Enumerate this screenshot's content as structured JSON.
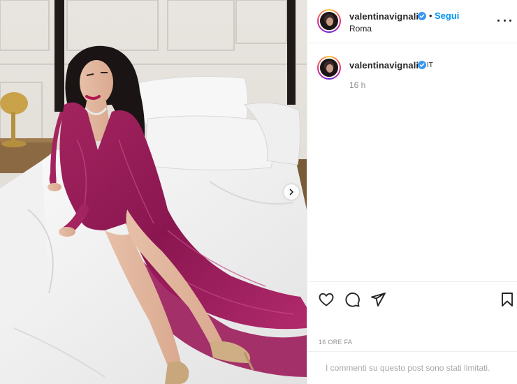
{
  "post": {
    "username": "valentinavignali",
    "follow_label": "Segui",
    "location": "Roma",
    "caption_username": "valentinavignali",
    "caption_language": "IT",
    "caption_time": "16 h",
    "date_label": "16 ORE FA",
    "comments_limited_text": "I commenti su questo post sono stati limitati."
  },
  "icons": {
    "verified": "verified-badge-icon",
    "more": "more-options-icon",
    "like": "heart-icon",
    "comment": "comment-bubble-icon",
    "share": "share-plane-icon",
    "save": "bookmark-icon",
    "next": "chevron-right-icon"
  },
  "colors": {
    "accent": "#0095f6",
    "verified": "#3897f0",
    "text": "#262626",
    "muted": "#8e8e8e",
    "divider": "#efefef",
    "dress": "#9c1f5f"
  }
}
